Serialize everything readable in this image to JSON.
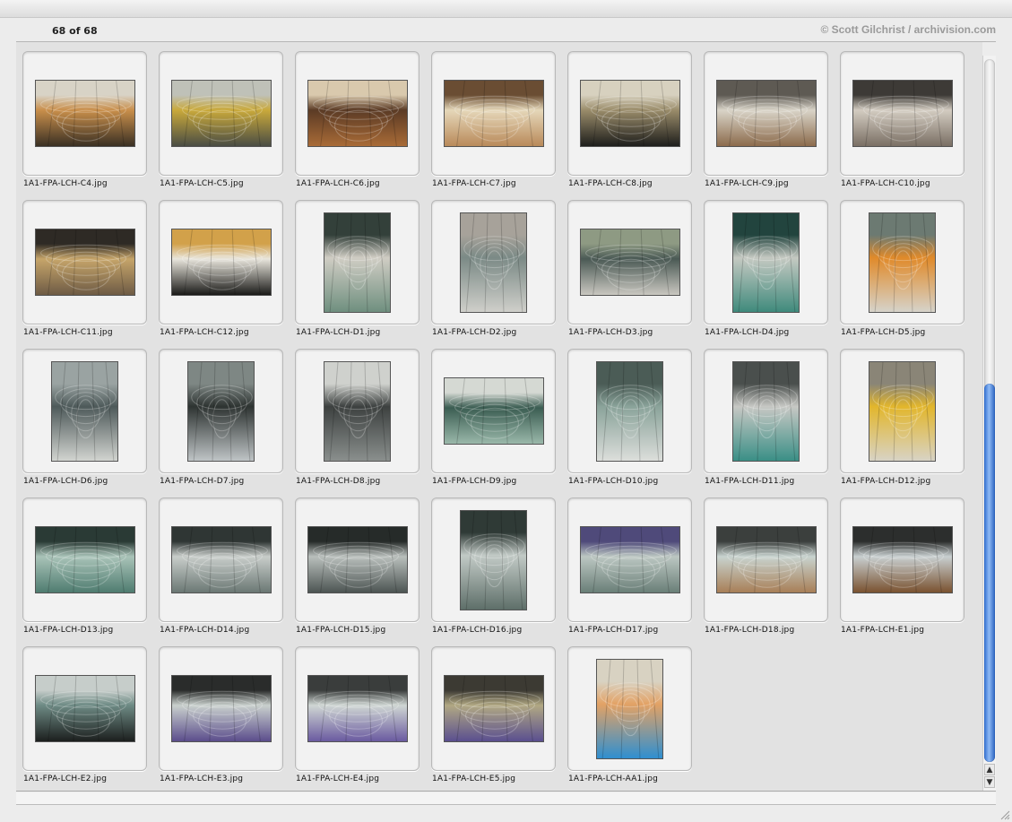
{
  "header": {
    "count_text": "68 of 68",
    "copyright": "© Scott Gilchrist / archivision.com"
  },
  "thumbnails": [
    {
      "file": "1A1-FPA-LCH-C4.jpg",
      "orient": "landscape",
      "palette": [
        "#3a3024",
        "#c98f4b",
        "#d8d3c6"
      ]
    },
    {
      "file": "1A1-FPA-LCH-C5.jpg",
      "orient": "landscape",
      "palette": [
        "#4a4d44",
        "#c9a93b",
        "#bfc1b8"
      ]
    },
    {
      "file": "1A1-FPA-LCH-C6.jpg",
      "orient": "landscape",
      "palette": [
        "#a96b37",
        "#5b3b25",
        "#d9c9ad"
      ]
    },
    {
      "file": "1A1-FPA-LCH-C7.jpg",
      "orient": "landscape",
      "palette": [
        "#b98a5a",
        "#e5d7b9",
        "#6a4d33"
      ]
    },
    {
      "file": "1A1-FPA-LCH-C8.jpg",
      "orient": "landscape",
      "palette": [
        "#1e1e1c",
        "#9a8c6a",
        "#d7d1bf"
      ]
    },
    {
      "file": "1A1-FPA-LCH-C9.jpg",
      "orient": "landscape",
      "palette": [
        "#8c6b4c",
        "#d9d4c8",
        "#5e5a53"
      ]
    },
    {
      "file": "1A1-FPA-LCH-C10.jpg",
      "orient": "landscape",
      "palette": [
        "#7a6f64",
        "#d3ccc1",
        "#3d3a36"
      ]
    },
    {
      "file": "1A1-FPA-LCH-C11.jpg",
      "orient": "landscape",
      "palette": [
        "#6e5b45",
        "#c6a56a",
        "#2e2a25"
      ]
    },
    {
      "file": "1A1-FPA-LCH-C12.jpg",
      "orient": "landscape",
      "palette": [
        "#1a1a18",
        "#e8e5dc",
        "#d2a14a"
      ]
    },
    {
      "file": "1A1-FPA-LCH-D1.jpg",
      "orient": "portrait",
      "palette": [
        "#6f8f7f",
        "#d0cdc4",
        "#33403a"
      ]
    },
    {
      "file": "1A1-FPA-LCH-D2.jpg",
      "orient": "portrait",
      "palette": [
        "#cfcfca",
        "#7b8a86",
        "#a7a29a"
      ]
    },
    {
      "file": "1A1-FPA-LCH-D3.jpg",
      "orient": "landscape",
      "palette": [
        "#c9c7c0",
        "#4b5a55",
        "#8e9a83"
      ]
    },
    {
      "file": "1A1-FPA-LCH-D4.jpg",
      "orient": "portrait",
      "palette": [
        "#3f8a7c",
        "#c5c9c2",
        "#22443e"
      ]
    },
    {
      "file": "1A1-FPA-LCH-D5.jpg",
      "orient": "portrait",
      "palette": [
        "#d6d3ca",
        "#e08a2a",
        "#6c7a72"
      ]
    },
    {
      "file": "1A1-FPA-LCH-D6.jpg",
      "orient": "portrait",
      "palette": [
        "#d2d4d0",
        "#4e5a5a",
        "#9aa3a2"
      ]
    },
    {
      "file": "1A1-FPA-LCH-D7.jpg",
      "orient": "portrait",
      "palette": [
        "#bfc4c6",
        "#2e3432",
        "#7e8784"
      ]
    },
    {
      "file": "1A1-FPA-LCH-D8.jpg",
      "orient": "portrait",
      "palette": [
        "#8a8f8d",
        "#3d4140",
        "#cfd1cd"
      ]
    },
    {
      "file": "1A1-FPA-LCH-D9.jpg",
      "orient": "landscape",
      "palette": [
        "#9ab8aa",
        "#3b5d52",
        "#d5d9d3"
      ]
    },
    {
      "file": "1A1-FPA-LCH-D10.jpg",
      "orient": "portrait",
      "palette": [
        "#dcdedb",
        "#8aa39a",
        "#4b5c56"
      ]
    },
    {
      "file": "1A1-FPA-LCH-D11.jpg",
      "orient": "portrait",
      "palette": [
        "#3a8f86",
        "#c7c8c4",
        "#4a4f4d"
      ]
    },
    {
      "file": "1A1-FPA-LCH-D12.jpg",
      "orient": "portrait",
      "palette": [
        "#d8d3c5",
        "#e2b62c",
        "#8a8577"
      ]
    },
    {
      "file": "1A1-FPA-LCH-D13.jpg",
      "orient": "landscape",
      "palette": [
        "#4f7c70",
        "#a9c3b8",
        "#2a3a35"
      ]
    },
    {
      "file": "1A1-FPA-LCH-D14.jpg",
      "orient": "landscape",
      "palette": [
        "#6b7874",
        "#c8cdca",
        "#2f3634"
      ]
    },
    {
      "file": "1A1-FPA-LCH-D15.jpg",
      "orient": "landscape",
      "palette": [
        "#4d5553",
        "#b9bfbc",
        "#262b29"
      ]
    },
    {
      "file": "1A1-FPA-LCH-D16.jpg",
      "orient": "portrait",
      "palette": [
        "#5e6f69",
        "#c2cac6",
        "#2f3a36"
      ]
    },
    {
      "file": "1A1-FPA-LCH-D17.jpg",
      "orient": "landscape",
      "palette": [
        "#6a7f78",
        "#bcc7c2",
        "#4f4a7a"
      ]
    },
    {
      "file": "1A1-FPA-LCH-D18.jpg",
      "orient": "landscape",
      "palette": [
        "#a87f57",
        "#c8d3cf",
        "#3b3f3d"
      ]
    },
    {
      "file": "1A1-FPA-LCH-E1.jpg",
      "orient": "landscape",
      "palette": [
        "#7a5230",
        "#c8cfd0",
        "#2c2e2d"
      ]
    },
    {
      "file": "1A1-FPA-LCH-E2.jpg",
      "orient": "landscape",
      "palette": [
        "#1c1f1e",
        "#6d8a84",
        "#c6cdca"
      ]
    },
    {
      "file": "1A1-FPA-LCH-E3.jpg",
      "orient": "landscape",
      "palette": [
        "#5b4d8c",
        "#c9d0cd",
        "#2a2c2b"
      ]
    },
    {
      "file": "1A1-FPA-LCH-E4.jpg",
      "orient": "landscape",
      "palette": [
        "#6a5aa0",
        "#cfd6d3",
        "#3a3d3c"
      ]
    },
    {
      "file": "1A1-FPA-LCH-E5.jpg",
      "orient": "landscape",
      "palette": [
        "#5a4f8f",
        "#b1a883",
        "#3c3a33"
      ]
    },
    {
      "file": "1A1-FPA-LCH-AA1.jpg",
      "orient": "portrait",
      "palette": [
        "#2f8fd0",
        "#e3a265",
        "#d8d2c2"
      ]
    }
  ],
  "colors": {
    "scroll_thumb": "#3f7ddb",
    "background": "#e2e2e2"
  },
  "icons": {
    "scroll_up": "▲",
    "scroll_down": "▼"
  }
}
